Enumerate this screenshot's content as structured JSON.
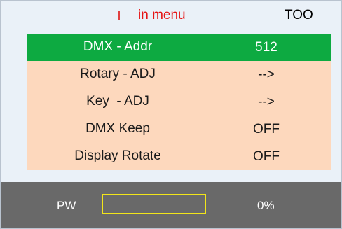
{
  "header": {
    "menu_label": "in menu",
    "right_label": "TOO"
  },
  "menu": {
    "items": [
      {
        "label": "DMX - Addr",
        "value": "512",
        "selected": true
      },
      {
        "label": "Rotary - ADJ",
        "value": "-->",
        "selected": false
      },
      {
        "label": "Key  - ADJ",
        "value": "-->",
        "selected": false
      },
      {
        "label": "DMX Keep",
        "value": "OFF",
        "selected": false
      },
      {
        "label": "Display Rotate",
        "value": "OFF",
        "selected": false
      }
    ]
  },
  "footer": {
    "pw_label": "PW",
    "progress": 0,
    "percent_text": "0%"
  },
  "colors": {
    "selected_row": "#0daa41",
    "row": "#fdd8bd",
    "header_text_accent": "#e51515",
    "footer_bg": "#696969",
    "progress_border": "#f2e51a"
  }
}
